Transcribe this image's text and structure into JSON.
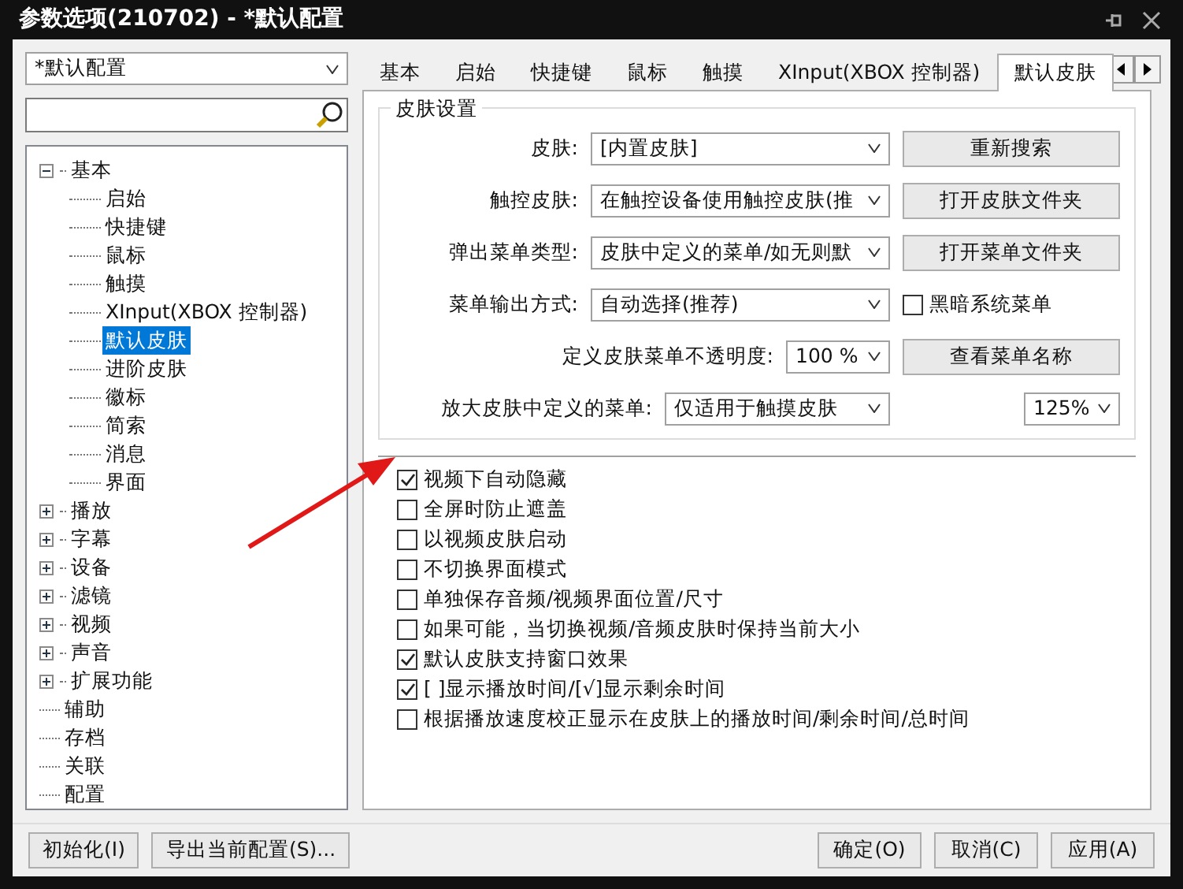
{
  "window": {
    "title": "参数选项(210702) - *默认配置"
  },
  "profile_select": {
    "value": "*默认配置"
  },
  "tree": [
    {
      "label": "基本",
      "kind": "group",
      "expanded": true,
      "selected": false,
      "children": [
        {
          "label": "启始",
          "selected": false
        },
        {
          "label": "快捷键",
          "selected": false
        },
        {
          "label": "鼠标",
          "selected": false
        },
        {
          "label": "触摸",
          "selected": false
        },
        {
          "label": "XInput(XBOX 控制器)",
          "selected": false
        },
        {
          "label": "默认皮肤",
          "selected": true
        },
        {
          "label": "进阶皮肤",
          "selected": false
        },
        {
          "label": "徽标",
          "selected": false
        },
        {
          "label": "简索",
          "selected": false
        },
        {
          "label": "消息",
          "selected": false
        },
        {
          "label": "界面",
          "selected": false
        }
      ]
    },
    {
      "label": "播放",
      "kind": "group",
      "expanded": false,
      "selected": false
    },
    {
      "label": "字幕",
      "kind": "group",
      "expanded": false,
      "selected": false
    },
    {
      "label": "设备",
      "kind": "group",
      "expanded": false,
      "selected": false
    },
    {
      "label": "滤镜",
      "kind": "group",
      "expanded": false,
      "selected": false
    },
    {
      "label": "视频",
      "kind": "group",
      "expanded": false,
      "selected": false
    },
    {
      "label": "声音",
      "kind": "group",
      "expanded": false,
      "selected": false
    },
    {
      "label": "扩展功能",
      "kind": "group",
      "expanded": false,
      "selected": false
    },
    {
      "label": "辅助",
      "kind": "leaf",
      "selected": false
    },
    {
      "label": "存档",
      "kind": "leaf",
      "selected": false
    },
    {
      "label": "关联",
      "kind": "leaf",
      "selected": false
    },
    {
      "label": "配置",
      "kind": "leaf",
      "selected": false
    }
  ],
  "tabs": [
    {
      "label": "基本",
      "selected": false
    },
    {
      "label": "启始",
      "selected": false
    },
    {
      "label": "快捷键",
      "selected": false
    },
    {
      "label": "鼠标",
      "selected": false
    },
    {
      "label": "触摸",
      "selected": false
    },
    {
      "label": "XInput(XBOX 控制器)",
      "selected": false
    },
    {
      "label": "默认皮肤",
      "selected": true
    }
  ],
  "skin_group": {
    "title": "皮肤设置",
    "rows": [
      {
        "kind": "wide",
        "label": "皮肤:",
        "select": "[内置皮肤]",
        "button": "重新搜索"
      },
      {
        "kind": "wide",
        "label": "触控皮肤:",
        "select": "在触控设备使用触控皮肤(推",
        "button": "打开皮肤文件夹"
      },
      {
        "kind": "wide",
        "label": "弹出菜单类型:",
        "select": "皮肤中定义的菜单/如无则默",
        "button": "打开菜单文件夹"
      },
      {
        "kind": "wide_check",
        "label": "菜单输出方式:",
        "select": "自动选择(推荐)",
        "checkbox": {
          "label": "黑暗系统菜单",
          "checked": false
        }
      },
      {
        "kind": "narrow",
        "label": "定义皮肤菜单不透明度:",
        "select": "100 %",
        "button": "查看菜单名称"
      },
      {
        "kind": "double",
        "label": "放大皮肤中定义的菜单:",
        "select": "仅适用于触摸皮肤",
        "select2": "125%"
      }
    ]
  },
  "options": [
    {
      "label": "视频下自动隐藏",
      "checked": true
    },
    {
      "label": "全屏时防止遮盖",
      "checked": false
    },
    {
      "label": "以视频皮肤启动",
      "checked": false
    },
    {
      "label": "不切换界面模式",
      "checked": false
    },
    {
      "label": "单独保存音频/视频界面位置/尺寸",
      "checked": false
    },
    {
      "label": "如果可能，当切换视频/音频皮肤时保持当前大小",
      "checked": false
    },
    {
      "label": "默认皮肤支持窗口效果",
      "checked": true
    },
    {
      "label": "[  ]显示播放时间/[√]显示剩余时间",
      "checked": true
    },
    {
      "label": "根据播放速度校正显示在皮肤上的播放时间/剩余时间/总时间",
      "checked": false
    }
  ],
  "footer": {
    "left_buttons": [
      "初始化(I)",
      "导出当前配置(S)..."
    ],
    "right_buttons": [
      "确定(O)",
      "取消(C)",
      "应用(A)"
    ]
  }
}
